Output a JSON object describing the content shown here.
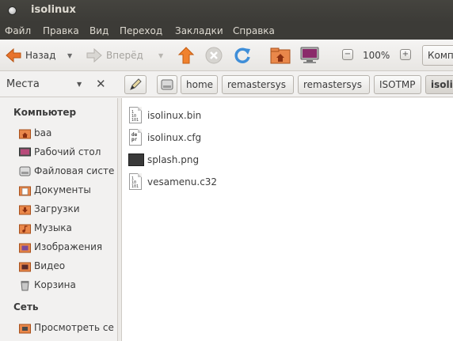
{
  "window": {
    "title": "isolinux"
  },
  "menubar": {
    "items": [
      {
        "label": "Файл"
      },
      {
        "label": "Правка"
      },
      {
        "label": "Вид"
      },
      {
        "label": "Переход"
      },
      {
        "label": "Закладки"
      },
      {
        "label": "Справка"
      }
    ]
  },
  "toolbar": {
    "back_label": "Назад",
    "forward_label": "Вперёд",
    "zoom_value": "100%",
    "view_mode_label": "Компактный вид"
  },
  "location": {
    "places_label": "Места",
    "crumbs": [
      {
        "label": "home"
      },
      {
        "label": "remastersys"
      },
      {
        "label": "remastersys"
      },
      {
        "label": "ISOTMP"
      },
      {
        "label": "isolinux"
      }
    ]
  },
  "sidebar": {
    "computer_header": "Компьютер",
    "computer_items": [
      {
        "label": "baa",
        "icon": "home-folder-icon"
      },
      {
        "label": "Рабочий стол",
        "icon": "desktop-icon"
      },
      {
        "label": "Файловая система",
        "icon": "drive-icon"
      },
      {
        "label": "Документы",
        "icon": "documents-folder-icon"
      },
      {
        "label": "Загрузки",
        "icon": "downloads-folder-icon"
      },
      {
        "label": "Музыка",
        "icon": "music-folder-icon"
      },
      {
        "label": "Изображения",
        "icon": "pictures-folder-icon"
      },
      {
        "label": "Видео",
        "icon": "videos-folder-icon"
      },
      {
        "label": "Корзина",
        "icon": "trash-icon"
      }
    ],
    "network_header": "Сеть",
    "network_items": [
      {
        "label": "Просмотреть сеть",
        "icon": "network-icon"
      }
    ]
  },
  "files": [
    {
      "name": "isolinux.bin",
      "icon": "binary-file-icon"
    },
    {
      "name": "isolinux.cfg",
      "icon": "config-file-icon"
    },
    {
      "name": "splash.png",
      "icon": "image-file-icon"
    },
    {
      "name": "vesamenu.c32",
      "icon": "binary-file-icon"
    }
  ],
  "colors": {
    "titlebar": "#3c3b37",
    "accent_orange": "#f07746",
    "reload_blue": "#3f8ed8"
  }
}
